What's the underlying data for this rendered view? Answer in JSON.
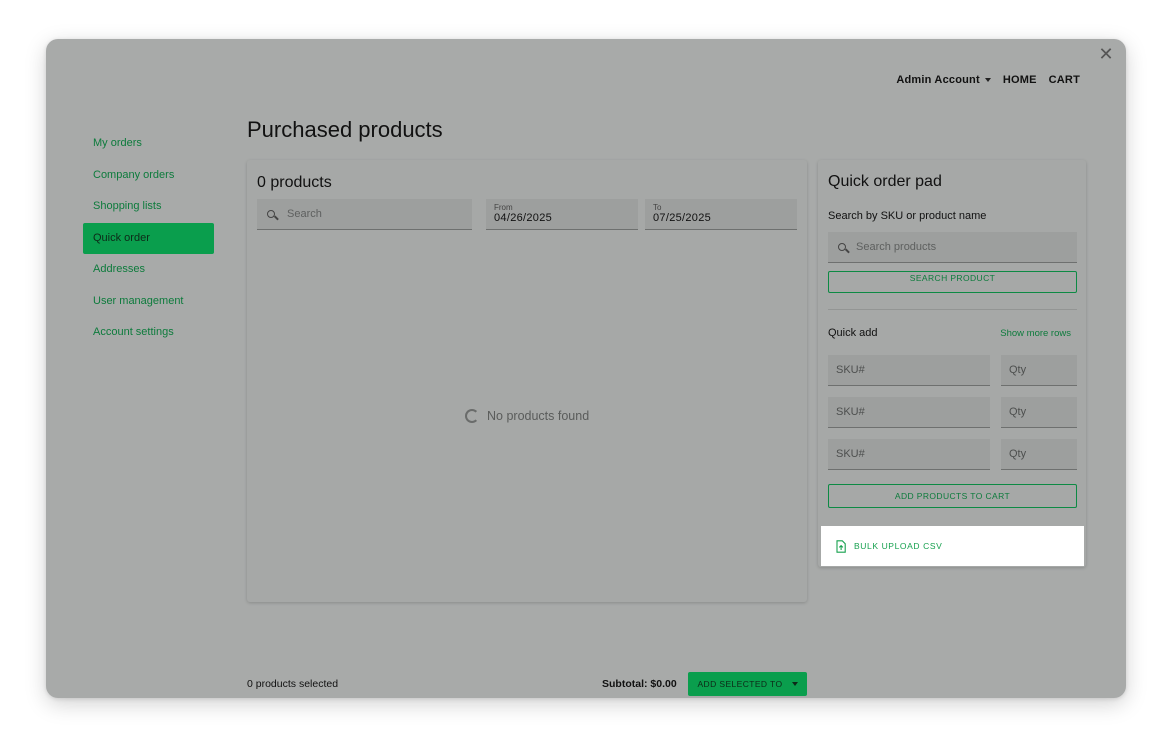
{
  "topnav": {
    "account": "Admin Account",
    "links": [
      "HOME",
      "CART"
    ]
  },
  "sidebar": {
    "items": [
      {
        "label": "My orders"
      },
      {
        "label": "Company orders"
      },
      {
        "label": "Shopping lists"
      },
      {
        "label": "Quick order",
        "active": true
      },
      {
        "label": "Addresses"
      },
      {
        "label": "User management"
      },
      {
        "label": "Account settings"
      }
    ]
  },
  "page": {
    "title": "Purchased products"
  },
  "products": {
    "heading": "0 products",
    "search_placeholder": "Search",
    "from_label": "From",
    "from_value": "04/26/2025",
    "to_label": "To",
    "to_value": "07/25/2025",
    "empty_message": "No products found"
  },
  "quick_order": {
    "heading": "Quick order pad",
    "search_label": "Search by SKU or product name",
    "search_placeholder": "Search products",
    "search_button": "SEARCH PRODUCT",
    "quick_add_label": "Quick add",
    "show_more": "Show more rows",
    "rows": [
      {
        "sku_placeholder": "SKU#",
        "qty_placeholder": "Qty"
      },
      {
        "sku_placeholder": "SKU#",
        "qty_placeholder": "Qty"
      },
      {
        "sku_placeholder": "SKU#",
        "qty_placeholder": "Qty"
      }
    ],
    "add_button": "ADD PRODUCTS TO CART",
    "bulk_upload": "BULK UPLOAD CSV"
  },
  "footer": {
    "selected": "0 products selected",
    "subtotal": "Subtotal: $0.00",
    "add_selected": "ADD SELECTED TO"
  },
  "colors": {
    "accent": "#0a9e4d",
    "link": "#0d7b3c",
    "overlay": "#a8aaa9"
  }
}
